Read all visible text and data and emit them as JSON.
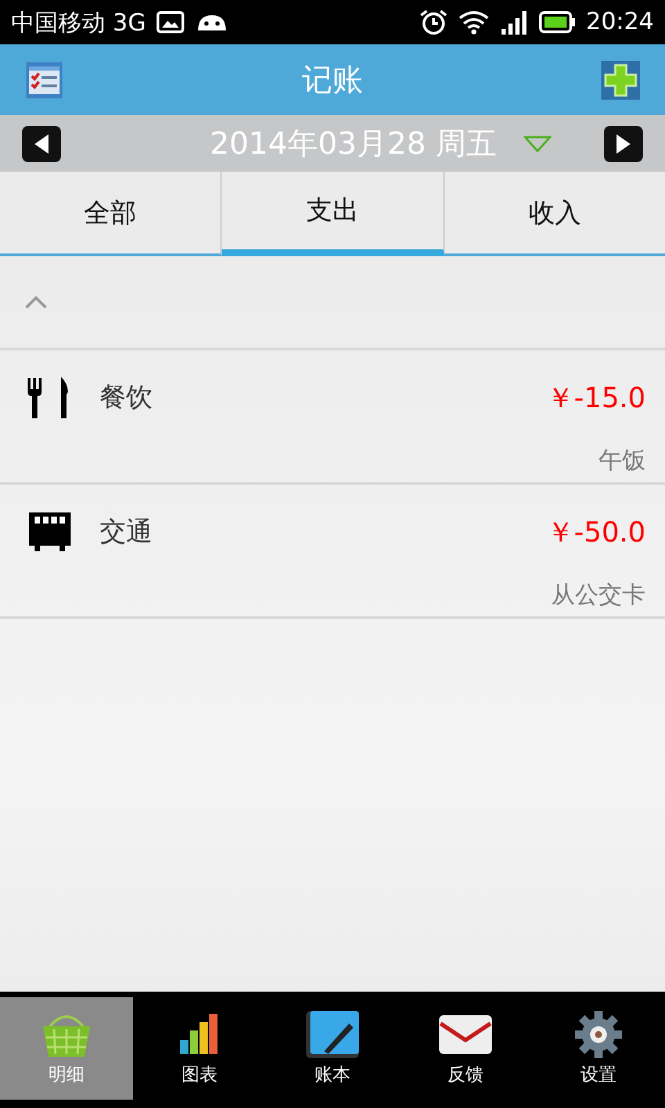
{
  "status_bar": {
    "carrier": "中国移动 3G",
    "time": "20:24"
  },
  "header": {
    "title": "记账"
  },
  "date_bar": {
    "date": "2014年03月28 周五"
  },
  "tabs": [
    {
      "label": "全部",
      "selected": false
    },
    {
      "label": "支出",
      "selected": true
    },
    {
      "label": "收入",
      "selected": false
    }
  ],
  "entries": [
    {
      "kind": "food",
      "category": "餐饮",
      "amount": "￥-15.0",
      "note": "午饭"
    },
    {
      "kind": "bus",
      "category": "交通",
      "amount": "￥-50.0",
      "note": "从公交卡"
    }
  ],
  "bottom_nav": [
    {
      "kind": "basket",
      "label": "明细",
      "selected": true
    },
    {
      "kind": "chart",
      "label": "图表",
      "selected": false
    },
    {
      "kind": "notebook",
      "label": "账本",
      "selected": false
    },
    {
      "kind": "mail",
      "label": "反馈",
      "selected": false
    },
    {
      "kind": "gear",
      "label": "设置",
      "selected": false
    }
  ]
}
